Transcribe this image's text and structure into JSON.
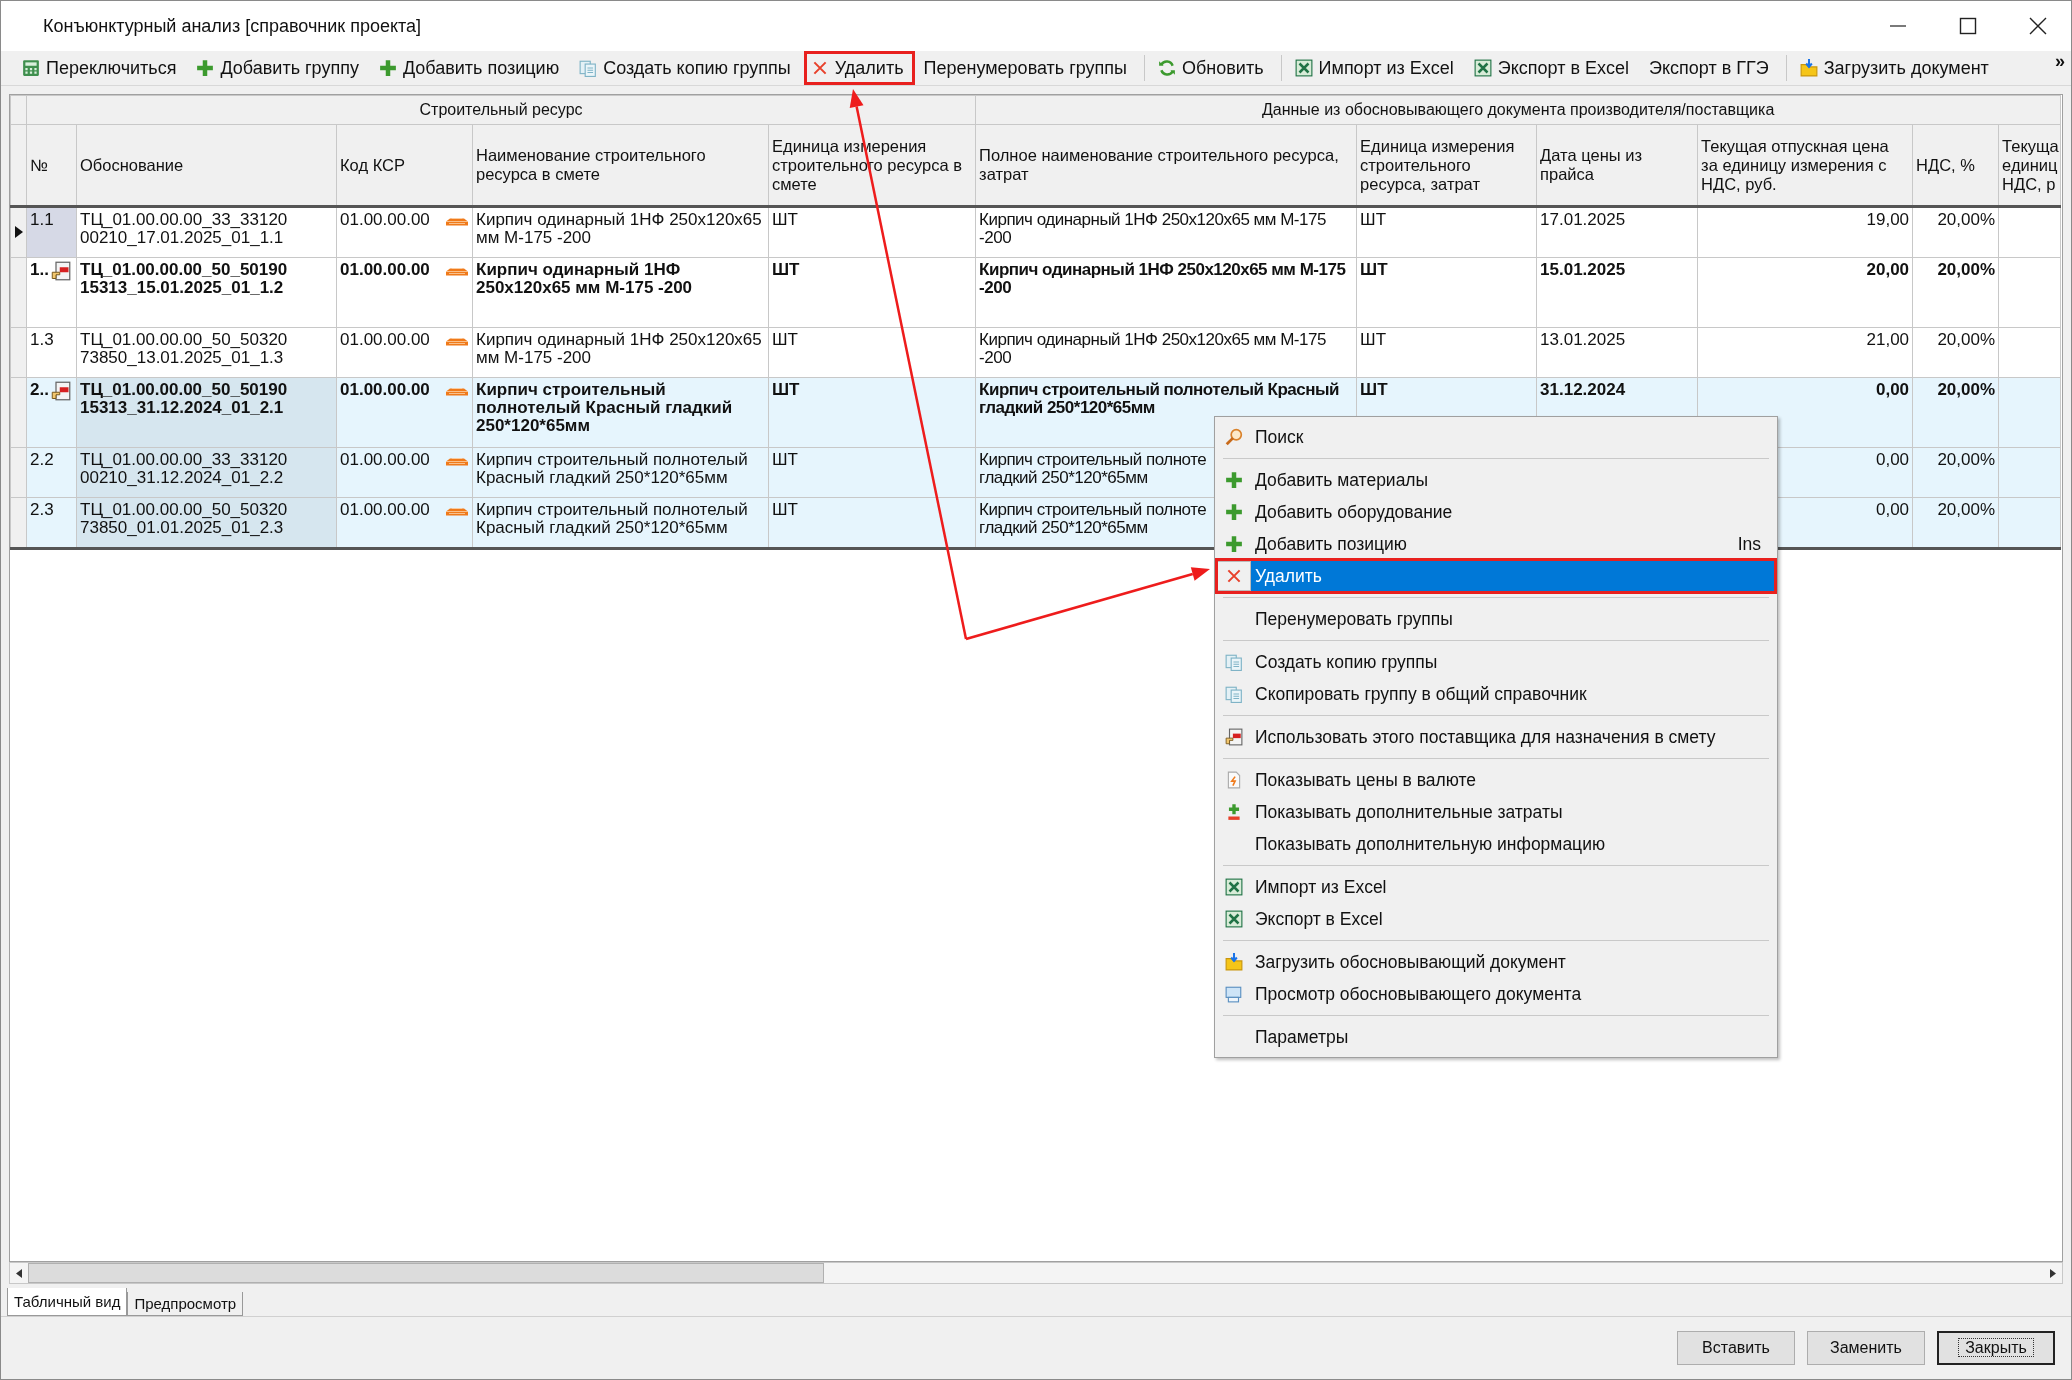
{
  "window": {
    "title": "Конъюнктурный анализ [справочник проекта]"
  },
  "toolbar": [
    {
      "label": "Переключиться",
      "kind": "calc",
      "boxed": false,
      "divider_after": false
    },
    {
      "label": "Добавить группу",
      "kind": "plus",
      "boxed": false,
      "divider_after": false
    },
    {
      "label": "Добавить позицию",
      "kind": "plus",
      "boxed": false,
      "divider_after": false
    },
    {
      "label": "Создать копию группы",
      "kind": "copy",
      "boxed": false,
      "divider_after": false
    },
    {
      "label": "Удалить",
      "kind": "cross",
      "boxed": true,
      "divider_after": false
    },
    {
      "label": "Перенумеровать группы",
      "kind": "none",
      "boxed": false,
      "divider_after": true
    },
    {
      "label": "Обновить",
      "kind": "refresh",
      "boxed": false,
      "divider_after": true
    },
    {
      "label": "Импорт из Excel",
      "kind": "excel",
      "boxed": false,
      "divider_after": false
    },
    {
      "label": "Экспорт в Excel",
      "kind": "excel",
      "boxed": false,
      "divider_after": false
    },
    {
      "label": "Экспорт в ГГЭ",
      "kind": "none",
      "boxed": false,
      "divider_after": true
    },
    {
      "label": "Загрузить документ",
      "kind": "folder",
      "boxed": false,
      "divider_after": false
    }
  ],
  "toolbar_overflow": "»",
  "table": {
    "column_groups": [
      {
        "label": "Строительный ресурс"
      },
      {
        "label": "Данные из обосновывающего документа производителя/поставщика"
      }
    ],
    "columns": [
      "№",
      "Обоснование",
      "Код КСР",
      "Наименование строительного ресурса в смете",
      "Единица измерения строительного ресурса в смете",
      "Полное наименование строительного ресурса, затрат",
      "Единица измерения строительного ресурса, затрат",
      "Дата цены из прайса",
      "Текущая отпускная цена за единицу измерения с НДС, руб.",
      "НДС, %",
      "Текуща\nединиц\nНДС, р"
    ],
    "rows": [
      {
        "number": "1.1",
        "kind": "item",
        "current": true,
        "selected": false,
        "basis": "ТЦ_01.00.00.00_33_33120 00210_17.01.2025_01_1.1",
        "ksr_code": "01.00.00.00",
        "name": "Кирпич одинарный 1НФ 250x120x65 мм М-175 -200",
        "unit": "ШТ",
        "full_name": "Кирпич одинарный 1НФ 250x120x65 мм М-175 -200",
        "unit2": "ШТ",
        "price_date": "17.01.2025",
        "price": "19,00",
        "vat": "20,00%"
      },
      {
        "number": "1..",
        "kind": "group",
        "current": false,
        "selected": false,
        "basis": "ТЦ_01.00.00.00_50_50190 15313_15.01.2025_01_1.2",
        "ksr_code": "01.00.00.00",
        "name": "Кирпич одинарный 1НФ 250x120x65 мм М-175 -200",
        "unit": "ШТ",
        "full_name": "Кирпич одинарный 1НФ 250x120x65 мм М-175 -200",
        "unit2": "ШТ",
        "price_date": "15.01.2025",
        "price": "20,00",
        "vat": "20,00%"
      },
      {
        "number": "1.3",
        "kind": "item",
        "current": false,
        "selected": false,
        "basis": "ТЦ_01.00.00.00_50_50320 73850_13.01.2025_01_1.3",
        "ksr_code": "01.00.00.00",
        "name": "Кирпич одинарный 1НФ 250x120x65 мм М-175 -200",
        "unit": "ШТ",
        "full_name": "Кирпич одинарный 1НФ 250x120x65 мм М-175 -200",
        "unit2": "ШТ",
        "price_date": "13.01.2025",
        "price": "21,00",
        "vat": "20,00%"
      },
      {
        "number": "2..",
        "kind": "group",
        "current": false,
        "selected": true,
        "basis": "ТЦ_01.00.00.00_50_50190 15313_31.12.2024_01_2.1",
        "ksr_code": "01.00.00.00",
        "name": "Кирпич строительный полнотелый Красный гладкий 250*120*65мм",
        "unit": "ШТ",
        "full_name": "Кирпич строительный полнотелый Красный гладкий 250*120*65мм",
        "unit2": "ШТ",
        "price_date": "31.12.2024",
        "price": "0,00",
        "vat": "20,00%"
      },
      {
        "number": "2.2",
        "kind": "item",
        "current": false,
        "selected": true,
        "basis": "ТЦ_01.00.00.00_33_33120 00210_31.12.2024_01_2.2",
        "ksr_code": "01.00.00.00",
        "name": "Кирпич строительный полнотелый Красный гладкий 250*120*65мм",
        "unit": "ШТ",
        "full_name": "Кирпич строительный полноте\nгладкий 250*120*65мм",
        "price": "0,00",
        "vat": "20,00%"
      },
      {
        "number": "2.3",
        "kind": "item",
        "current": false,
        "selected": true,
        "basis": "ТЦ_01.00.00.00_50_50320 73850_01.01.2025_01_2.3",
        "ksr_code": "01.00.00.00",
        "name": "Кирпич строительный полнотелый Красный гладкий 250*120*65мм",
        "unit": "ШТ",
        "full_name": "Кирпич строительный полноте\nгладкий 250*120*65мм",
        "price": "0,00",
        "vat": "20,00%"
      }
    ]
  },
  "context_menu": {
    "sections": [
      [
        {
          "label": "Поиск",
          "kind": "search",
          "selected": false,
          "boxed": false
        }
      ],
      [
        {
          "label": "Добавить материалы",
          "kind": "plus",
          "selected": false,
          "boxed": false
        },
        {
          "label": "Добавить оборудование",
          "kind": "plus",
          "selected": false,
          "boxed": false
        },
        {
          "label": "Добавить позицию",
          "kind": "plus",
          "selected": false,
          "boxed": false,
          "shortcut": "Ins"
        },
        {
          "label": "Удалить",
          "kind": "cross",
          "selected": true,
          "boxed": true
        }
      ],
      [
        {
          "label": "Перенумеровать группы",
          "kind": "none",
          "selected": false,
          "boxed": false
        }
      ],
      [
        {
          "label": "Создать копию группы",
          "kind": "copy",
          "selected": false,
          "boxed": false
        },
        {
          "label": "Скопировать группу в общий справочник",
          "kind": "copy",
          "selected": false,
          "boxed": false
        }
      ],
      [
        {
          "label": "Использовать этого поставщика для назначения в смету",
          "kind": "handdoc",
          "selected": false,
          "boxed": false
        }
      ],
      [
        {
          "label": "Показывать цены в валюте",
          "kind": "currency",
          "selected": false,
          "boxed": false
        },
        {
          "label": "Показывать дополнительные затраты",
          "kind": "plusminus",
          "selected": false,
          "boxed": false
        },
        {
          "label": "Показывать дополнительную информацию",
          "kind": "none",
          "selected": false,
          "boxed": false
        }
      ],
      [
        {
          "label": "Импорт из Excel",
          "kind": "excel",
          "selected": false,
          "boxed": false
        },
        {
          "label": "Экспорт в Excel",
          "kind": "excel",
          "selected": false,
          "boxed": false
        }
      ],
      [
        {
          "label": "Загрузить обосновывающий документ",
          "kind": "folder",
          "selected": false,
          "boxed": false
        },
        {
          "label": "Просмотр обосновывающего документа",
          "kind": "docview",
          "selected": false,
          "boxed": false
        }
      ],
      [
        {
          "label": "Параметры",
          "kind": "none",
          "selected": false,
          "boxed": false
        }
      ]
    ]
  },
  "view_tabs": [
    {
      "label": "Табличный вид",
      "selected": true
    },
    {
      "label": "Предпросмотр",
      "selected": false
    }
  ],
  "buttons": [
    {
      "label": "Вставить",
      "default": false
    },
    {
      "label": "Заменить",
      "default": false
    },
    {
      "label": "Закрыть",
      "default": true
    }
  ]
}
